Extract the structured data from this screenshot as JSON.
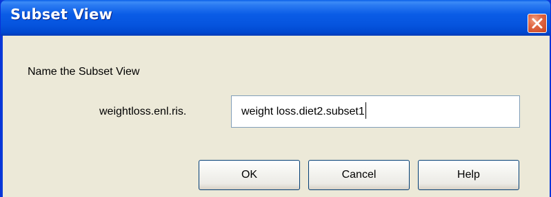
{
  "window": {
    "title": "Subset View"
  },
  "dialog": {
    "prompt": "Name the Subset View",
    "field_label": "weightloss.enl.ris.",
    "input_value": "weight loss.diet2.subset1"
  },
  "buttons": {
    "ok": "OK",
    "cancel": "Cancel",
    "help": "Help"
  },
  "icons": {
    "close": "close-icon"
  },
  "colors": {
    "titlebar": "#0a5ce6",
    "dialog_background": "#ece9d8",
    "close_button": "#e06845"
  }
}
